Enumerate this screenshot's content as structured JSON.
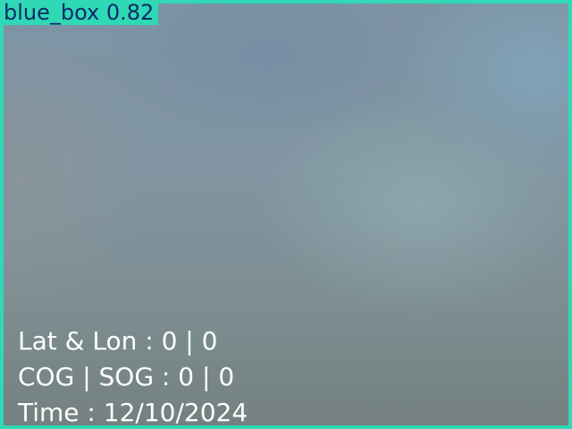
{
  "detection": {
    "label": "blue_box 0.82",
    "box_color": "#2fd9b6",
    "label_text_color": "#0f2a66"
  },
  "overlay": {
    "lat_lon": "Lat & Lon : 0 | 0",
    "cog_sog": "COG | SOG : 0 | 0",
    "time": "Time : 12/10/2024",
    "text_color": "#ffffff"
  }
}
